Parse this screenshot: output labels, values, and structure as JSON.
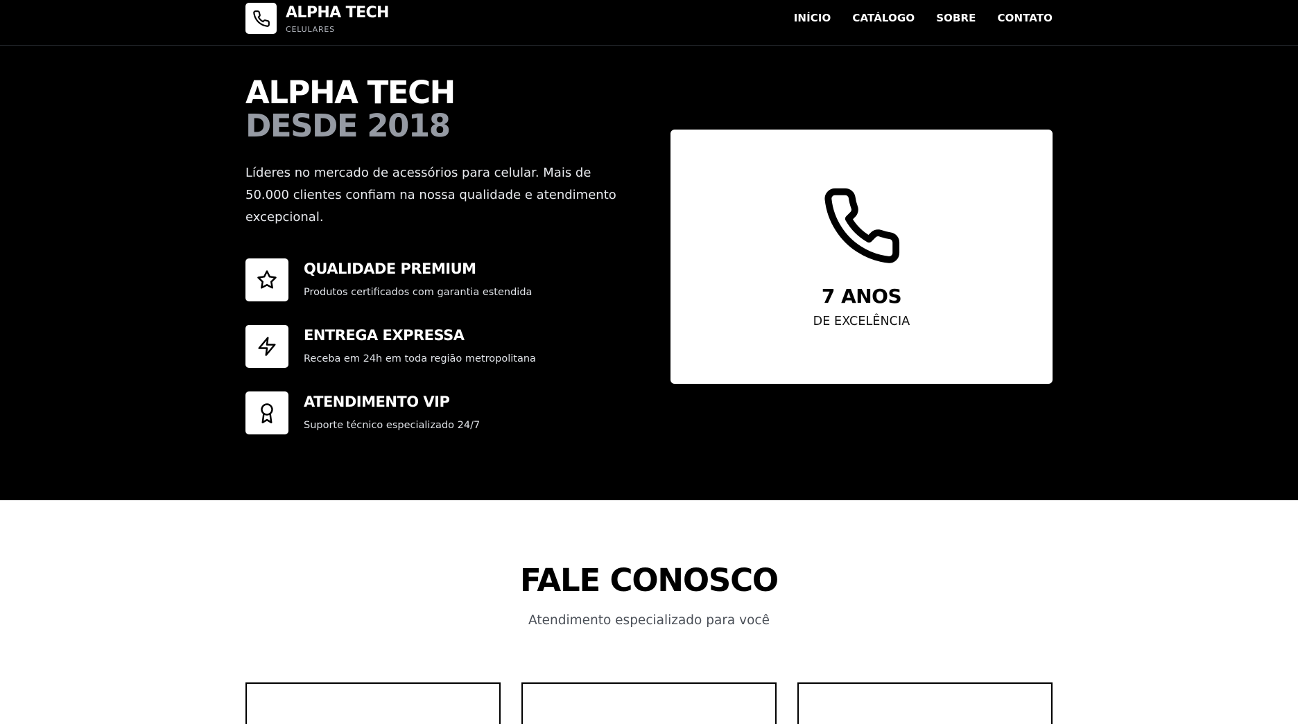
{
  "nav": {
    "brand_name": "ALPHA TECH",
    "brand_sub": "CELULARES",
    "links": [
      "INÍCIO",
      "CATÁLOGO",
      "SOBRE",
      "CONTATO"
    ]
  },
  "hero": {
    "title_line1": "ALPHA TECH",
    "title_line2": "DESDE 2018",
    "description": "Líderes no mercado de acessórios para celular. Mais de 50.000 clientes confiam na nossa qualidade e atendimento excepcional.",
    "features": [
      {
        "title": "QUALIDADE PREMIUM",
        "desc": "Produtos certificados com garantia estendida",
        "icon": "star-icon"
      },
      {
        "title": "ENTREGA EXPRESSA",
        "desc": "Receba em 24h em toda região metropolitana",
        "icon": "lightning-icon"
      },
      {
        "title": "ATENDIMENTO VIP",
        "desc": "Suporte técnico especializado 24/7",
        "icon": "award-icon"
      }
    ],
    "experience": {
      "years": "7 ANOS",
      "label": "DE EXCELÊNCIA",
      "icon": "phone-icon"
    }
  },
  "contact": {
    "title": "FALE CONOSCO",
    "subtitle": "Atendimento especializado para você"
  },
  "colors": {
    "background_dark": "#000000",
    "accent_gray": "#959aa3",
    "card_white": "#ffffff"
  }
}
